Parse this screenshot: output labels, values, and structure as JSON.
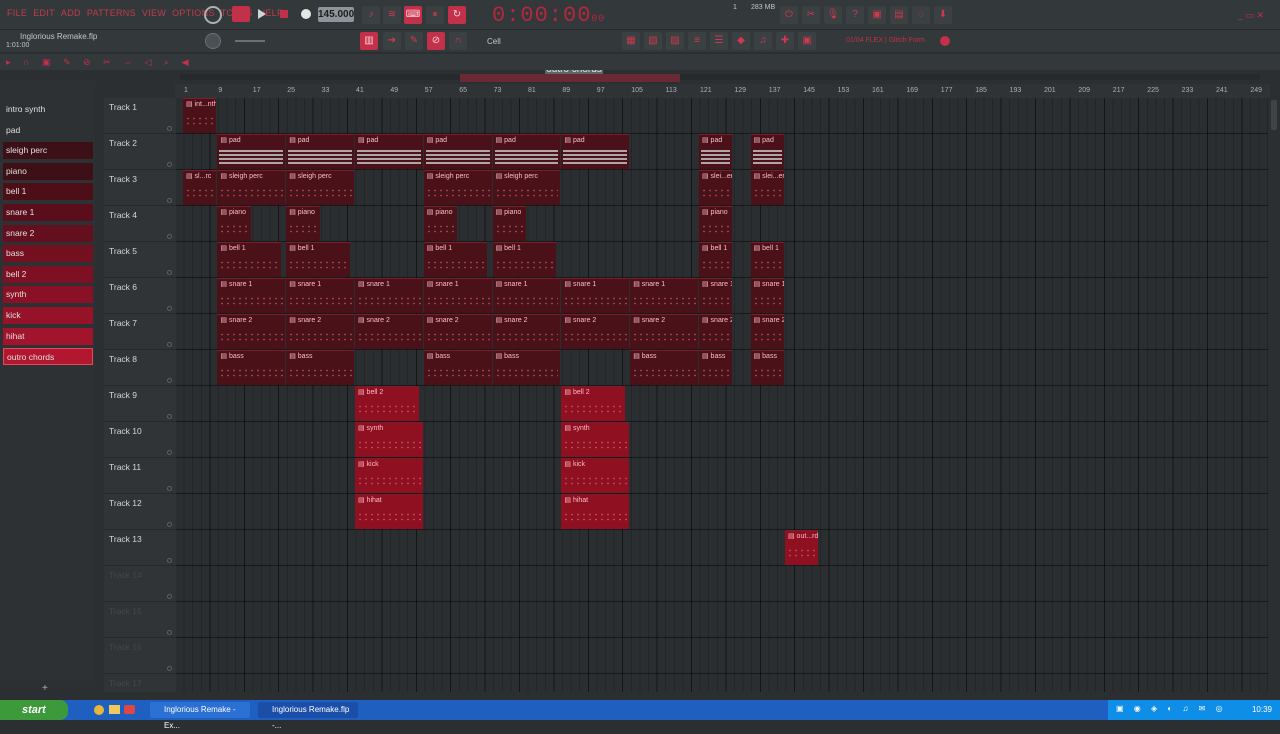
{
  "menu": [
    "FILE",
    "EDIT",
    "ADD",
    "PATTERNS",
    "VIEW",
    "OPTIONS",
    "TOOLS",
    "HELP"
  ],
  "project": {
    "filename": "Inglorious Remake.flp",
    "position": "1:01:00",
    "tempo": "145.000",
    "time": "0:00:00",
    "time_small": "00",
    "memory": "283 MB"
  },
  "toolbar": {
    "pattern": "outro chords",
    "snap": "Cell",
    "news": "FLEX | Glitch Form",
    "news_prefix": "01/04"
  },
  "breadcrumb": [
    "Playlist",
    "Arrangement",
    "outro chords"
  ],
  "ruler": [
    "1",
    "9",
    "17",
    "25",
    "33",
    "41",
    "49",
    "57",
    "65",
    "73",
    "81",
    "89",
    "97",
    "105",
    "113",
    "121",
    "129",
    "137",
    "145",
    "153",
    "161",
    "169",
    "177",
    "185",
    "193",
    "201",
    "209",
    "217",
    "225",
    "233",
    "241",
    "249"
  ],
  "patterns": [
    "intro synth",
    "pad",
    "sleigh perc",
    "piano",
    "bell 1",
    "snare 1",
    "snare 2",
    "bass",
    "bell 2",
    "synth",
    "kick",
    "hihat",
    "outro chords"
  ],
  "tracks": [
    "Track 1",
    "Track 2",
    "Track 3",
    "Track 4",
    "Track 5",
    "Track 6",
    "Track 7",
    "Track 8",
    "Track 9",
    "Track 10",
    "Track 11",
    "Track 12",
    "Track 13",
    "Track 14",
    "Track 15",
    "Track 16",
    "Track 17"
  ],
  "clips": [
    {
      "track": 1,
      "start": 1,
      "end": 9,
      "label": "int...nth",
      "kind": "dots"
    },
    {
      "track": 2,
      "start": 9,
      "end": 25,
      "label": "pad",
      "kind": "lines"
    },
    {
      "track": 2,
      "start": 25,
      "end": 41,
      "label": "pad",
      "kind": "lines"
    },
    {
      "track": 2,
      "start": 41,
      "end": 57,
      "label": "pad",
      "kind": "lines"
    },
    {
      "track": 2,
      "start": 57,
      "end": 73,
      "label": "pad",
      "kind": "lines"
    },
    {
      "track": 2,
      "start": 73,
      "end": 89,
      "label": "pad",
      "kind": "lines"
    },
    {
      "track": 2,
      "start": 89,
      "end": 105,
      "label": "pad",
      "kind": "lines"
    },
    {
      "track": 2,
      "start": 121,
      "end": 129,
      "label": "pad",
      "kind": "lines"
    },
    {
      "track": 2,
      "start": 133,
      "end": 141,
      "label": "pad",
      "kind": "lines"
    },
    {
      "track": 3,
      "start": 1,
      "end": 9,
      "label": "sl...rc",
      "kind": "dots"
    },
    {
      "track": 3,
      "start": 9,
      "end": 25,
      "label": "sleigh perc",
      "kind": "dots"
    },
    {
      "track": 3,
      "start": 25,
      "end": 41,
      "label": "sleigh perc",
      "kind": "dots"
    },
    {
      "track": 3,
      "start": 57,
      "end": 73,
      "label": "sleigh perc",
      "kind": "dots"
    },
    {
      "track": 3,
      "start": 73,
      "end": 89,
      "label": "sleigh perc",
      "kind": "dots"
    },
    {
      "track": 3,
      "start": 121,
      "end": 129,
      "label": "slei...erc",
      "kind": "dots"
    },
    {
      "track": 3,
      "start": 133,
      "end": 141,
      "label": "slei...erc",
      "kind": "dots"
    },
    {
      "track": 4,
      "start": 9,
      "end": 17,
      "label": "piano",
      "kind": "dots"
    },
    {
      "track": 4,
      "start": 25,
      "end": 33,
      "label": "piano",
      "kind": "dots"
    },
    {
      "track": 4,
      "start": 57,
      "end": 65,
      "label": "piano",
      "kind": "dots"
    },
    {
      "track": 4,
      "start": 73,
      "end": 81,
      "label": "piano",
      "kind": "dots"
    },
    {
      "track": 4,
      "start": 121,
      "end": 129,
      "label": "piano",
      "kind": "dots"
    },
    {
      "track": 5,
      "start": 9,
      "end": 24,
      "label": "bell 1",
      "kind": "dots"
    },
    {
      "track": 5,
      "start": 25,
      "end": 40,
      "label": "bell 1",
      "kind": "dots"
    },
    {
      "track": 5,
      "start": 57,
      "end": 72,
      "label": "bell 1",
      "kind": "dots"
    },
    {
      "track": 5,
      "start": 73,
      "end": 88,
      "label": "bell 1",
      "kind": "dots"
    },
    {
      "track": 5,
      "start": 121,
      "end": 129,
      "label": "bell 1",
      "kind": "dots"
    },
    {
      "track": 5,
      "start": 133,
      "end": 141,
      "label": "bell 1",
      "kind": "dots"
    },
    {
      "track": 6,
      "start": 9,
      "end": 25,
      "label": "snare 1",
      "kind": "dots"
    },
    {
      "track": 6,
      "start": 25,
      "end": 41,
      "label": "snare 1",
      "kind": "dots"
    },
    {
      "track": 6,
      "start": 41,
      "end": 57,
      "label": "snare 1",
      "kind": "dots"
    },
    {
      "track": 6,
      "start": 57,
      "end": 73,
      "label": "snare 1",
      "kind": "dots"
    },
    {
      "track": 6,
      "start": 73,
      "end": 89,
      "label": "snare 1",
      "kind": "dots"
    },
    {
      "track": 6,
      "start": 89,
      "end": 105,
      "label": "snare 1",
      "kind": "dots"
    },
    {
      "track": 6,
      "start": 105,
      "end": 121,
      "label": "snare 1",
      "kind": "dots"
    },
    {
      "track": 6,
      "start": 121,
      "end": 129,
      "label": "snare 1",
      "kind": "dots"
    },
    {
      "track": 6,
      "start": 133,
      "end": 141,
      "label": "snare 1",
      "kind": "dots"
    },
    {
      "track": 7,
      "start": 9,
      "end": 25,
      "label": "snare 2",
      "kind": "dots"
    },
    {
      "track": 7,
      "start": 25,
      "end": 41,
      "label": "snare 2",
      "kind": "dots"
    },
    {
      "track": 7,
      "start": 41,
      "end": 57,
      "label": "snare 2",
      "kind": "dots"
    },
    {
      "track": 7,
      "start": 57,
      "end": 73,
      "label": "snare 2",
      "kind": "dots"
    },
    {
      "track": 7,
      "start": 73,
      "end": 89,
      "label": "snare 2",
      "kind": "dots"
    },
    {
      "track": 7,
      "start": 89,
      "end": 105,
      "label": "snare 2",
      "kind": "dots"
    },
    {
      "track": 7,
      "start": 105,
      "end": 121,
      "label": "snare 2",
      "kind": "dots"
    },
    {
      "track": 7,
      "start": 121,
      "end": 129,
      "label": "snare 2",
      "kind": "dots"
    },
    {
      "track": 7,
      "start": 133,
      "end": 141,
      "label": "snare 2",
      "kind": "dots"
    },
    {
      "track": 8,
      "start": 9,
      "end": 25,
      "label": "bass",
      "kind": "dots"
    },
    {
      "track": 8,
      "start": 25,
      "end": 41,
      "label": "bass",
      "kind": "dots"
    },
    {
      "track": 8,
      "start": 57,
      "end": 73,
      "label": "bass",
      "kind": "dots"
    },
    {
      "track": 8,
      "start": 73,
      "end": 89,
      "label": "bass",
      "kind": "dots"
    },
    {
      "track": 8,
      "start": 105,
      "end": 121,
      "label": "bass",
      "kind": "dots"
    },
    {
      "track": 8,
      "start": 121,
      "end": 129,
      "label": "bass",
      "kind": "dots"
    },
    {
      "track": 8,
      "start": 133,
      "end": 141,
      "label": "bass",
      "kind": "dots"
    },
    {
      "track": 9,
      "start": 41,
      "end": 56,
      "label": "bell 2",
      "kind": "dots",
      "bright": true
    },
    {
      "track": 9,
      "start": 89,
      "end": 104,
      "label": "bell 2",
      "kind": "dots",
      "bright": true
    },
    {
      "track": 10,
      "start": 41,
      "end": 57,
      "label": "synth",
      "kind": "dots",
      "bright": true
    },
    {
      "track": 10,
      "start": 89,
      "end": 105,
      "label": "synth",
      "kind": "dots",
      "bright": true
    },
    {
      "track": 11,
      "start": 41,
      "end": 57,
      "label": "kick",
      "kind": "dots",
      "bright": true
    },
    {
      "track": 11,
      "start": 89,
      "end": 105,
      "label": "kick",
      "kind": "dots",
      "bright": true
    },
    {
      "track": 12,
      "start": 41,
      "end": 57,
      "label": "hihat",
      "kind": "dots",
      "bright": true
    },
    {
      "track": 12,
      "start": 89,
      "end": 105,
      "label": "hihat",
      "kind": "dots",
      "bright": true
    },
    {
      "track": 13,
      "start": 141,
      "end": 149,
      "label": "out...rds",
      "kind": "dots",
      "bright": true
    }
  ],
  "taskbar": {
    "start": "start",
    "tasks": [
      "Inglorious Remake - Ex...",
      "Inglorious Remake.flp -..."
    ],
    "clock": "10:39"
  },
  "colors": {
    "accent": "#c2304a",
    "clip_dark": "#4b1119",
    "clip_bright": "#8e1021",
    "background": "#2b2f32"
  }
}
